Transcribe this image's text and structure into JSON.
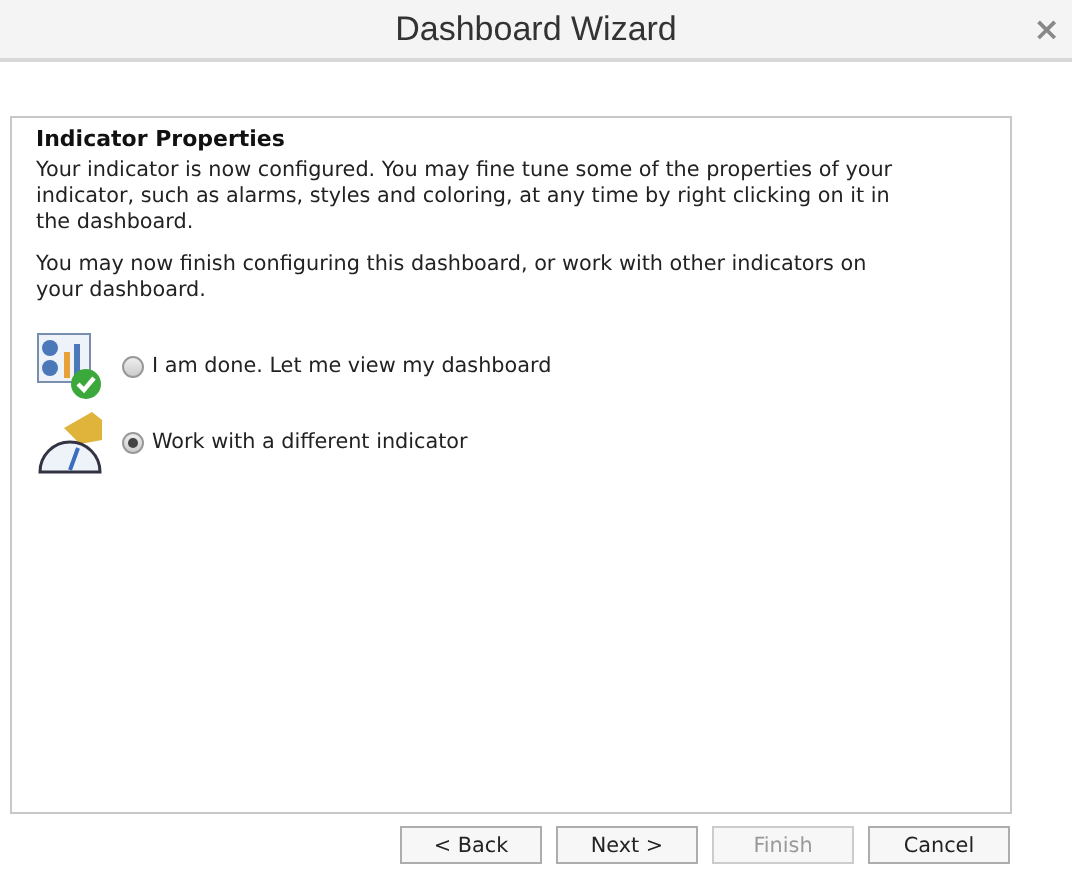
{
  "window": {
    "title": "Dashboard Wizard",
    "close": "×"
  },
  "panel": {
    "heading": "Indicator Properties",
    "paragraphs": [
      "Your indicator is now configured. You may fine tune some of the properties of your indicator, such as alarms, styles and coloring, at any time by right clicking on it in the dashboard.",
      "You may now finish configuring this dashboard, or work with other indicators on your dashboard."
    ],
    "options": [
      {
        "kind": "dashboard",
        "label": "I am done. Let me view my dashboard",
        "selected": false
      },
      {
        "kind": "indicator",
        "label": "Work with a different indicator",
        "selected": true
      }
    ]
  },
  "buttons": [
    {
      "label": "< Back",
      "disabled": false
    },
    {
      "label": "Next >",
      "disabled": false
    },
    {
      "label": "Finish",
      "disabled": true
    },
    {
      "label": "Cancel",
      "disabled": false
    }
  ]
}
